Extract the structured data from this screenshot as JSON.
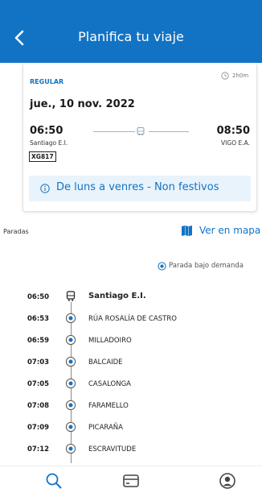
{
  "header": {
    "title": "Planifica tu viaje",
    "back_icon": "chevron-left-icon",
    "color": "#1273c4"
  },
  "trip": {
    "type": "REGULAR",
    "duration": "2h0m",
    "date": "jue., 10 nov. 2022",
    "departure_time": "06:50",
    "departure_stop": "Santiago E.I.",
    "arrival_time": "08:50",
    "arrival_stop": "VIGO E.A.",
    "code": "XG817",
    "notice": "De luns a venres - Non festivos"
  },
  "stops_section": {
    "label": "Paradas",
    "map_link": "Ver en mapa",
    "legend": "Parada bajo demanda"
  },
  "stops": [
    {
      "time": "06:50",
      "name": "Santiago E.I.",
      "icon": "bus-icon"
    },
    {
      "time": "06:53",
      "name": "RÚA ROSALÍA DE CASTRO",
      "icon": "on-demand-stop-icon"
    },
    {
      "time": "06:59",
      "name": "MILLADOIRO",
      "icon": "on-demand-stop-icon"
    },
    {
      "time": "07:03",
      "name": "BALCAIDE",
      "icon": "on-demand-stop-icon"
    },
    {
      "time": "07:05",
      "name": "CASALONGA",
      "icon": "on-demand-stop-icon"
    },
    {
      "time": "07:08",
      "name": "FARAMELLO",
      "icon": "on-demand-stop-icon"
    },
    {
      "time": "07:09",
      "name": "PICARAÑA",
      "icon": "on-demand-stop-icon"
    },
    {
      "time": "07:12",
      "name": "ESCRAVITUDE",
      "icon": "on-demand-stop-icon"
    }
  ],
  "bottom_nav": [
    {
      "icon": "search-icon",
      "active": true
    },
    {
      "icon": "card-icon",
      "active": false
    },
    {
      "icon": "profile-icon",
      "active": false
    }
  ],
  "colors": {
    "accent": "#1273c4",
    "notice_bg": "#e9f3fb"
  }
}
